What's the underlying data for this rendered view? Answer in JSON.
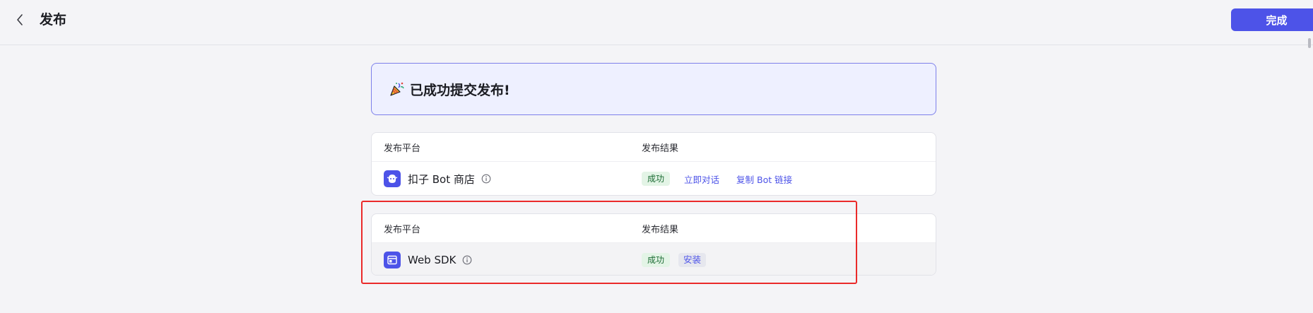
{
  "header": {
    "title": "发布",
    "done_label": "完成"
  },
  "banner": {
    "message": "已成功提交发布!"
  },
  "cards": [
    {
      "col_platform": "发布平台",
      "col_result": "发布结果",
      "platform_name": "扣子 Bot 商店",
      "status": "成功",
      "action_1": "立即对话",
      "action_2": "复制 Bot 链接"
    },
    {
      "col_platform": "发布平台",
      "col_result": "发布结果",
      "platform_name": "Web SDK",
      "status": "成功",
      "action_1": "安装"
    }
  ],
  "colors": {
    "accent": "#4d53e8",
    "success_bg": "#e3f4e6",
    "success_text": "#1b6b33",
    "highlight": "#ea2a2a"
  },
  "icons": {
    "back": "chevron-left-icon",
    "banner": "party-popper-icon",
    "bot_store": "bot-store-icon",
    "web_sdk": "browser-window-icon",
    "info": "info-circle-icon"
  }
}
